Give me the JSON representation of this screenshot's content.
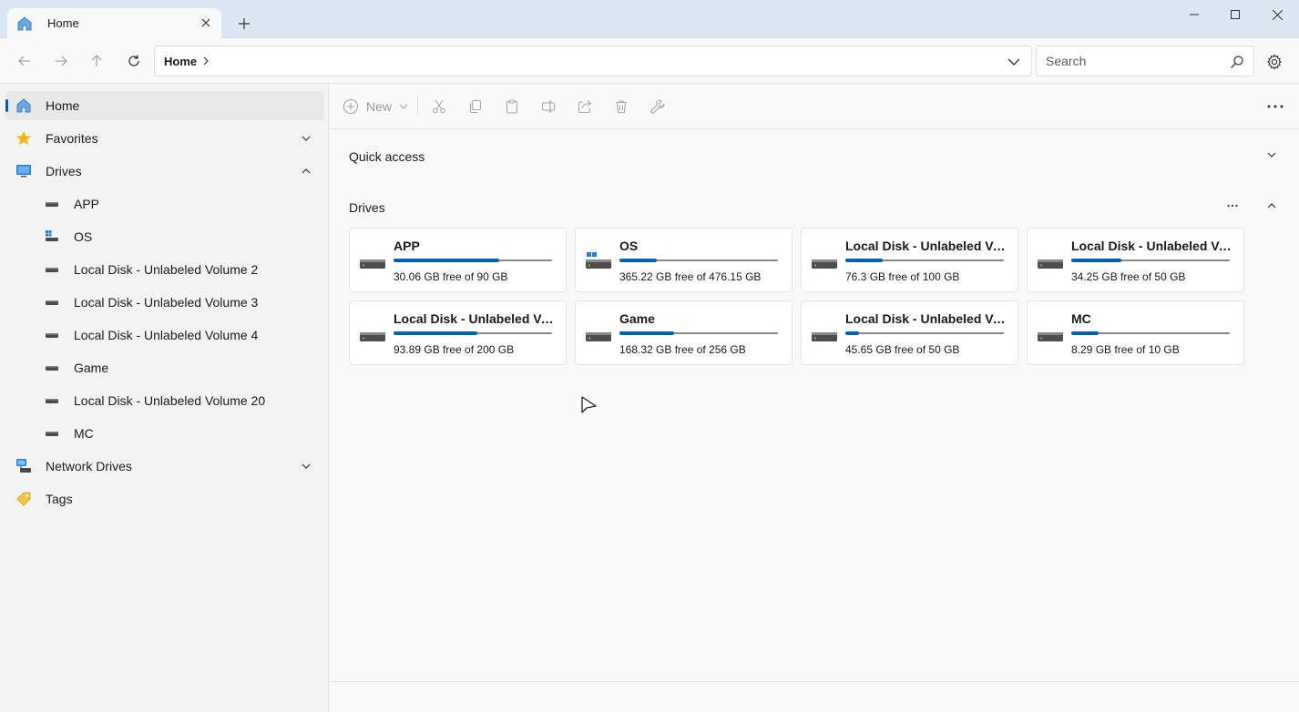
{
  "tab": {
    "title": "Home",
    "icon": "home-icon"
  },
  "nav": {
    "breadcrumb": "Home",
    "search_placeholder": "Search"
  },
  "sidebar": {
    "items": [
      {
        "label": "Home",
        "icon": "home-icon",
        "selected": true
      },
      {
        "label": "Favorites",
        "icon": "star-icon",
        "expander": "chevron-down"
      },
      {
        "label": "Drives",
        "icon": "monitor-icon",
        "expander": "chevron-up"
      },
      {
        "label": "APP",
        "icon": "drive-icon"
      },
      {
        "label": "OS",
        "icon": "windows-drive-icon"
      },
      {
        "label": "Local Disk - Unlabeled Volume 2",
        "icon": "drive-icon"
      },
      {
        "label": "Local Disk - Unlabeled Volume 3",
        "icon": "drive-icon"
      },
      {
        "label": "Local Disk - Unlabeled Volume 4",
        "icon": "drive-icon"
      },
      {
        "label": "Game",
        "icon": "drive-icon"
      },
      {
        "label": "Local Disk - Unlabeled Volume 20",
        "icon": "drive-icon"
      },
      {
        "label": "MC",
        "icon": "drive-icon"
      },
      {
        "label": "Network Drives",
        "icon": "network-drive-icon",
        "expander": "chevron-down"
      },
      {
        "label": "Tags",
        "icon": "tag-icon"
      }
    ]
  },
  "toolbar": {
    "new_label": "New",
    "actions": [
      "cut-icon",
      "copy-icon",
      "paste-icon",
      "rename-icon",
      "share-icon",
      "delete-icon",
      "properties-icon"
    ]
  },
  "main": {
    "quick_access_label": "Quick access",
    "drives_label": "Drives",
    "drives": [
      {
        "name": "APP",
        "free": "30.06 GB free of 90 GB",
        "used_fraction": 0.666
      },
      {
        "name": "OS",
        "free": "365.22 GB free of 476.15 GB",
        "used_fraction": 0.233
      },
      {
        "name": "Local Disk - Unlabeled Vo...",
        "free": "76.3 GB free of 100 GB",
        "used_fraction": 0.237
      },
      {
        "name": "Local Disk - Unlabeled Vo...",
        "free": "34.25 GB free of 50 GB",
        "used_fraction": 0.315
      },
      {
        "name": "Local Disk - Unlabeled Vo...",
        "free": "93.89 GB free of 200 GB",
        "used_fraction": 0.531
      },
      {
        "name": "Game",
        "free": "168.32 GB free of 256 GB",
        "used_fraction": 0.343
      },
      {
        "name": "Local Disk - Unlabeled Vo...",
        "free": "45.65 GB free of 50 GB",
        "used_fraction": 0.087
      },
      {
        "name": "MC",
        "free": "8.29 GB free of 10 GB",
        "used_fraction": 0.171
      }
    ]
  },
  "colors": {
    "accent": "#005fb8",
    "titlebar": "#dbe7f3"
  }
}
